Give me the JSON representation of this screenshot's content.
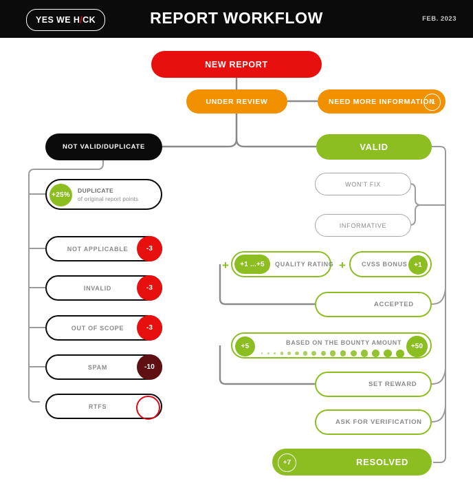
{
  "header": {
    "logo_text": "YES WE H",
    "logo_bolt": "/",
    "logo_tail": "CK",
    "title": "REPORT WORKFLOW",
    "date": "FEB. 2023"
  },
  "colors": {
    "red": "#e8100f",
    "orange": "#f29100",
    "green": "#8cbe22",
    "black": "#0b0b0b",
    "dark_red": "#5e1012",
    "gray_line": "#8a8a8a"
  },
  "flow": {
    "new_report": {
      "label": "NEW REPORT"
    },
    "under_review": {
      "label": "UNDER REVIEW"
    },
    "need_more_information": {
      "label": "NEED MORE INFORMATION",
      "points": "-1"
    },
    "not_valid_duplicate": {
      "label": "NOT VALID/DUPLICATE"
    },
    "valid": {
      "label": "VALID"
    },
    "resolved": {
      "label": "RESOLVED",
      "points": "+7"
    }
  },
  "not_valid_items": [
    {
      "label": "DUPLICATE",
      "sublabel": "of original report points",
      "points": "+25%",
      "badge_style": "green-left"
    },
    {
      "label": "NOT APPLICABLE",
      "points": "-3",
      "badge_style": "red"
    },
    {
      "label": "INVALID",
      "points": "-3",
      "badge_style": "red"
    },
    {
      "label": "OUT OF SCOPE",
      "points": "-3",
      "badge_style": "red"
    },
    {
      "label": "SPAM",
      "points": "-10",
      "badge_style": "dark-red"
    },
    {
      "label": "RTFS",
      "points": "",
      "badge_style": "red-ring"
    }
  ],
  "valid_items": {
    "wont_fix": {
      "label": "WON'T FIX"
    },
    "informative": {
      "label": "INFORMATIVE"
    },
    "quality_rating": {
      "label": "QUALITY RATING",
      "points": "+1 ...+5"
    },
    "plus_separator": "+",
    "cvss_bonus": {
      "label": "CVSS BONUS",
      "points": "+1"
    },
    "accepted": {
      "label": "ACCEPTED"
    },
    "bounty": {
      "label": "BASED ON THE BOUNTY AMOUNT",
      "points_min": "+5",
      "points_max": "+50",
      "dot_count": 16
    },
    "set_reward": {
      "label": "SET REWARD"
    },
    "ask_for_verification": {
      "label": "ASK FOR VERIFICATION"
    }
  }
}
